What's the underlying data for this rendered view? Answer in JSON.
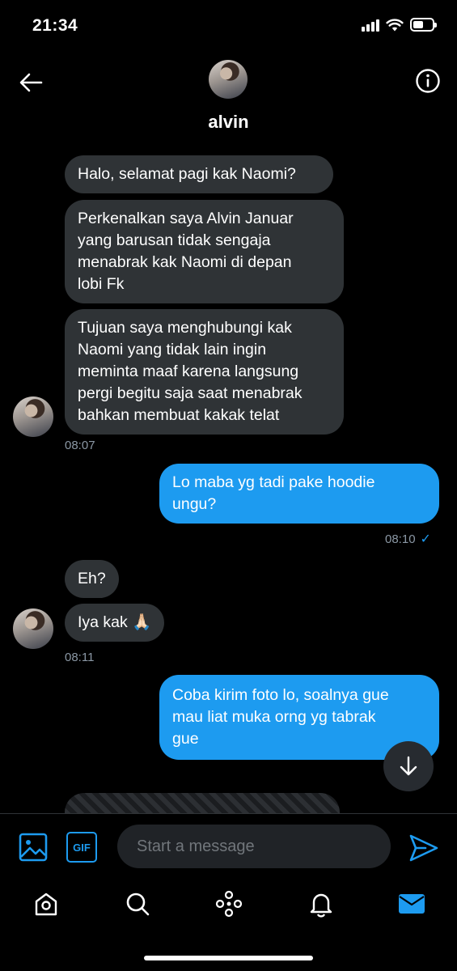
{
  "status_bar": {
    "time": "21:34"
  },
  "header": {
    "name": "alvin"
  },
  "messages": [
    {
      "direction": "in",
      "lines": [
        "Halo, selamat pagi kak Naomi?"
      ]
    },
    {
      "direction": "in",
      "lines": [
        "Perkenalkan saya Alvin Januar",
        "yang barusan tidak sengaja",
        "menabrak kak Naomi di depan",
        "lobi Fk"
      ]
    },
    {
      "direction": "in",
      "lines": [
        "Tujuan saya menghubungi kak",
        "Naomi yang tidak lain ingin",
        "meminta maaf karena langsung",
        "pergi begitu saja saat menabrak",
        "bahkan membuat kakak telat"
      ]
    },
    {
      "direction": "out",
      "lines": [
        "Lo maba yg tadi pake hoodie",
        "ungu?"
      ]
    },
    {
      "direction": "in",
      "lines": [
        "Eh?"
      ]
    },
    {
      "direction": "in",
      "lines": [
        "Iya kak 🙏🏻"
      ]
    },
    {
      "direction": "out",
      "lines": [
        "Coba kirim foto lo, soalnya gue",
        "mau liat muka orng yg tabrak",
        "gue"
      ]
    }
  ],
  "timestamps": {
    "group1": "08:07",
    "group2": "08:10",
    "group3": "08:11"
  },
  "status": {
    "read_check": "✓"
  },
  "composer": {
    "placeholder": "Start a message",
    "gif_label": "GIF"
  },
  "colors": {
    "accent": "#1d9bf0",
    "incoming_bubble": "#2f3336",
    "background": "#000000"
  },
  "icons": {
    "header": [
      "back-arrow-icon",
      "info-icon"
    ],
    "composer": [
      "media-icon",
      "gif-icon",
      "send-icon"
    ],
    "tabbar": [
      "home-icon",
      "search-icon",
      "spaces-icon",
      "notifications-icon",
      "messages-icon"
    ]
  }
}
